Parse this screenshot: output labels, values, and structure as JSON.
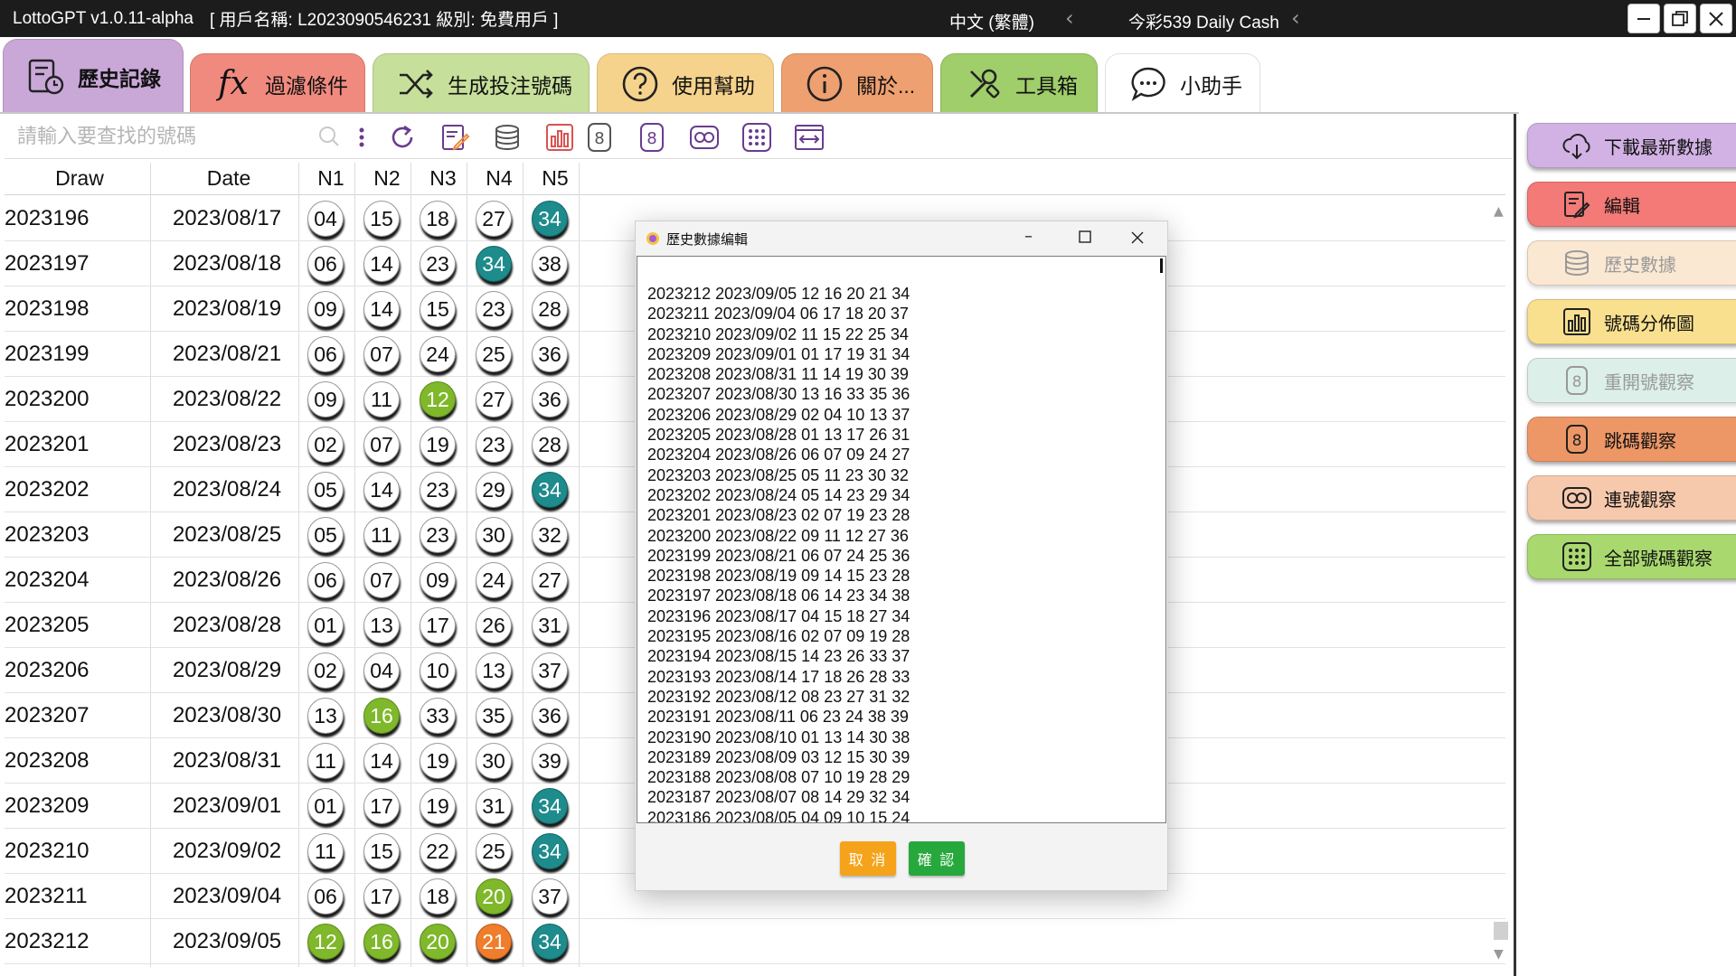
{
  "titlebar": {
    "app_title": "LottoGPT v1.0.11-alpha",
    "user_info": "[ 用戶名稱: L2023090546231  級別: 免費用戶 ]",
    "language": "中文 (繁體)",
    "game": "今彩539 Daily Cash"
  },
  "tabs": [
    {
      "label": "歷史記錄",
      "color": "#c9a8d8",
      "icon": "history-icon"
    },
    {
      "label": "過濾條件",
      "color": "#f08a7e",
      "icon": "fx-icon"
    },
    {
      "label": "生成投注號碼",
      "color": "#c6df9a",
      "icon": "shuffle-icon"
    },
    {
      "label": "使用幫助",
      "color": "#f6d38c",
      "icon": "help-icon"
    },
    {
      "label": "關於...",
      "color": "#eea070",
      "icon": "info-icon"
    },
    {
      "label": "工具箱",
      "color": "#9fce6a",
      "icon": "tools-icon"
    },
    {
      "label": "小助手",
      "color": "#ffffff",
      "icon": "chat-icon"
    }
  ],
  "search": {
    "placeholder": "請輸入要查找的號碼"
  },
  "table": {
    "headers": [
      "Draw",
      "Date",
      "N1",
      "N2",
      "N3",
      "N4",
      "N5"
    ],
    "rows": [
      {
        "draw": "2023196",
        "date": "2023/08/17",
        "nums": [
          "04",
          "15",
          "18",
          "27",
          "34"
        ],
        "hl": [
          "",
          "",
          "",
          "",
          "teal"
        ]
      },
      {
        "draw": "2023197",
        "date": "2023/08/18",
        "nums": [
          "06",
          "14",
          "23",
          "34",
          "38"
        ],
        "hl": [
          "",
          "",
          "",
          "teal",
          ""
        ]
      },
      {
        "draw": "2023198",
        "date": "2023/08/19",
        "nums": [
          "09",
          "14",
          "15",
          "23",
          "28"
        ],
        "hl": [
          "",
          "",
          "",
          "",
          ""
        ]
      },
      {
        "draw": "2023199",
        "date": "2023/08/21",
        "nums": [
          "06",
          "07",
          "24",
          "25",
          "36"
        ],
        "hl": [
          "",
          "",
          "",
          "",
          ""
        ]
      },
      {
        "draw": "2023200",
        "date": "2023/08/22",
        "nums": [
          "09",
          "11",
          "12",
          "27",
          "36"
        ],
        "hl": [
          "",
          "",
          "green",
          "",
          ""
        ]
      },
      {
        "draw": "2023201",
        "date": "2023/08/23",
        "nums": [
          "02",
          "07",
          "19",
          "23",
          "28"
        ],
        "hl": [
          "",
          "",
          "",
          "",
          ""
        ]
      },
      {
        "draw": "2023202",
        "date": "2023/08/24",
        "nums": [
          "05",
          "14",
          "23",
          "29",
          "34"
        ],
        "hl": [
          "",
          "",
          "",
          "",
          "teal"
        ]
      },
      {
        "draw": "2023203",
        "date": "2023/08/25",
        "nums": [
          "05",
          "11",
          "23",
          "30",
          "32"
        ],
        "hl": [
          "",
          "",
          "",
          "",
          ""
        ]
      },
      {
        "draw": "2023204",
        "date": "2023/08/26",
        "nums": [
          "06",
          "07",
          "09",
          "24",
          "27"
        ],
        "hl": [
          "",
          "",
          "",
          "",
          ""
        ]
      },
      {
        "draw": "2023205",
        "date": "2023/08/28",
        "nums": [
          "01",
          "13",
          "17",
          "26",
          "31"
        ],
        "hl": [
          "",
          "",
          "",
          "",
          ""
        ]
      },
      {
        "draw": "2023206",
        "date": "2023/08/29",
        "nums": [
          "02",
          "04",
          "10",
          "13",
          "37"
        ],
        "hl": [
          "",
          "",
          "",
          "",
          ""
        ]
      },
      {
        "draw": "2023207",
        "date": "2023/08/30",
        "nums": [
          "13",
          "16",
          "33",
          "35",
          "36"
        ],
        "hl": [
          "",
          "green",
          "",
          "",
          ""
        ]
      },
      {
        "draw": "2023208",
        "date": "2023/08/31",
        "nums": [
          "11",
          "14",
          "19",
          "30",
          "39"
        ],
        "hl": [
          "",
          "",
          "",
          "",
          ""
        ]
      },
      {
        "draw": "2023209",
        "date": "2023/09/01",
        "nums": [
          "01",
          "17",
          "19",
          "31",
          "34"
        ],
        "hl": [
          "",
          "",
          "",
          "",
          "teal"
        ]
      },
      {
        "draw": "2023210",
        "date": "2023/09/02",
        "nums": [
          "11",
          "15",
          "22",
          "25",
          "34"
        ],
        "hl": [
          "",
          "",
          "",
          "",
          "teal"
        ]
      },
      {
        "draw": "2023211",
        "date": "2023/09/04",
        "nums": [
          "06",
          "17",
          "18",
          "20",
          "37"
        ],
        "hl": [
          "",
          "",
          "",
          "green",
          ""
        ]
      },
      {
        "draw": "2023212",
        "date": "2023/09/05",
        "nums": [
          "12",
          "16",
          "20",
          "21",
          "34"
        ],
        "hl": [
          "green",
          "green",
          "green",
          "orange",
          "teal"
        ]
      }
    ]
  },
  "highlight_colors": {
    "teal": "#1e8b8c",
    "green": "#7fb82a",
    "orange": "#ef7d2c"
  },
  "right_panel": [
    {
      "label": "下載最新數據",
      "color": "#d2b2e4",
      "icon": "cloud-download-icon",
      "enabled": true
    },
    {
      "label": "編輯",
      "color": "#f37a76",
      "icon": "edit-icon",
      "enabled": true
    },
    {
      "label": "歷史數據",
      "color": "#fbe8d2",
      "icon": "database-icon",
      "enabled": false
    },
    {
      "label": "號碼分佈圖",
      "color": "#f9e08e",
      "icon": "bar-chart-icon",
      "enabled": true
    },
    {
      "label": "重開號觀察",
      "color": "#dcefe9",
      "icon": "repeat-number-icon",
      "enabled": false
    },
    {
      "label": "跳碼觀察",
      "color": "#ee9766",
      "icon": "skip-number-icon",
      "enabled": true
    },
    {
      "label": "連號觀察",
      "color": "#f7c9ac",
      "icon": "consecutive-icon",
      "enabled": true
    },
    {
      "label": "全部號碼觀察",
      "color": "#a9d96e",
      "icon": "all-numbers-icon",
      "enabled": true
    }
  ],
  "dialog": {
    "title": "歷史數據编輯",
    "lines": [
      "2023212 2023/09/05 12 16 20 21 34",
      "2023211 2023/09/04 06 17 18 20 37",
      "2023210 2023/09/02 11 15 22 25 34",
      "2023209 2023/09/01 01 17 19 31 34",
      "2023208 2023/08/31 11 14 19 30 39",
      "2023207 2023/08/30 13 16 33 35 36",
      "2023206 2023/08/29 02 04 10 13 37",
      "2023205 2023/08/28 01 13 17 26 31",
      "2023204 2023/08/26 06 07 09 24 27",
      "2023203 2023/08/25 05 11 23 30 32",
      "2023202 2023/08/24 05 14 23 29 34",
      "2023201 2023/08/23 02 07 19 23 28",
      "2023200 2023/08/22 09 11 12 27 36",
      "2023199 2023/08/21 06 07 24 25 36",
      "2023198 2023/08/19 09 14 15 23 28",
      "2023197 2023/08/18 06 14 23 34 38",
      "2023196 2023/08/17 04 15 18 27 34",
      "2023195 2023/08/16 02 07 09 19 28",
      "2023194 2023/08/15 14 23 26 33 37",
      "2023193 2023/08/14 17 18 26 28 33",
      "2023192 2023/08/12 08 23 27 31 32",
      "2023191 2023/08/11 06 23 24 38 39",
      "2023190 2023/08/10 01 13 14 30 38",
      "2023189 2023/08/09 03 12 15 30 39",
      "2023188 2023/08/08 07 10 19 28 29",
      "2023187 2023/08/07 08 14 29 32 34",
      "2023186 2023/08/05 04 09 10 15 24"
    ],
    "cancel_label": "取 消",
    "confirm_label": "確 認",
    "cancel_color": "#f5a31a",
    "confirm_color": "#27a83d"
  }
}
